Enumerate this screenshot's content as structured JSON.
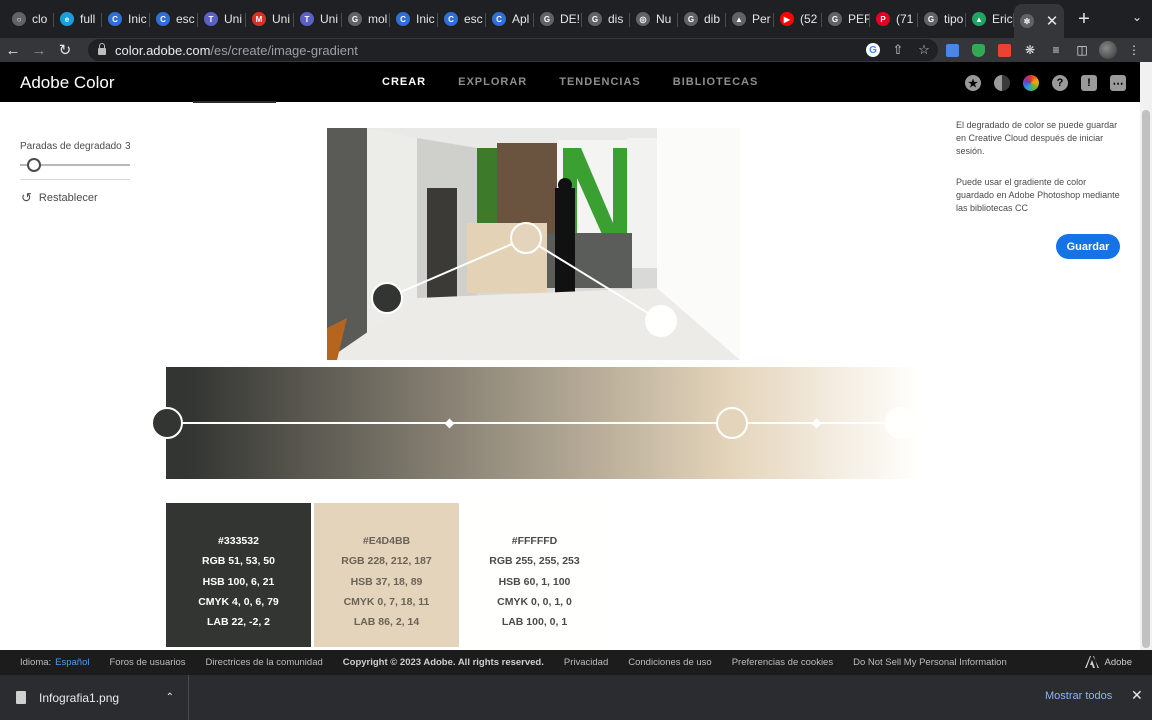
{
  "browser": {
    "tabs": [
      {
        "label": "clo",
        "icon": "globe-icon",
        "color": "#5f6368"
      },
      {
        "label": "full",
        "icon": "edge-icon",
        "color": "#1a9ee0"
      },
      {
        "label": "Inic",
        "icon": "c-icon",
        "color": "#2f6fd6"
      },
      {
        "label": "esc",
        "icon": "c-icon",
        "color": "#2f6fd6"
      },
      {
        "label": "Uni",
        "icon": "teams-icon",
        "color": "#5b5fc7"
      },
      {
        "label": "Uni",
        "icon": "gmail-icon",
        "color": "#d93025"
      },
      {
        "label": "Uni",
        "icon": "teams-icon",
        "color": "#5b5fc7"
      },
      {
        "label": "mol",
        "icon": "google-icon",
        "color": "#5f6368"
      },
      {
        "label": "Inic",
        "icon": "c-icon",
        "color": "#2f6fd6"
      },
      {
        "label": "esc",
        "icon": "c-icon",
        "color": "#2f6fd6"
      },
      {
        "label": "Apl",
        "icon": "c-icon",
        "color": "#2f6fd6"
      },
      {
        "label": "DE!",
        "icon": "google-icon",
        "color": "#5f6368"
      },
      {
        "label": "dis",
        "icon": "google-icon",
        "color": "#5f6368"
      },
      {
        "label": "Nu",
        "icon": "chrome-icon",
        "color": "#5f6368"
      },
      {
        "label": "dib",
        "icon": "google-icon",
        "color": "#5f6368"
      },
      {
        "label": "Per",
        "icon": "triangle-icon",
        "color": "#5f6368"
      },
      {
        "label": "(52",
        "icon": "youtube-icon",
        "color": "#ff0000"
      },
      {
        "label": "PEF",
        "icon": "google-icon",
        "color": "#5f6368"
      },
      {
        "label": "(71",
        "icon": "pinterest-icon",
        "color": "#e60023"
      },
      {
        "label": "tipo",
        "icon": "google-icon",
        "color": "#5f6368"
      },
      {
        "label": "Eric",
        "icon": "drive-icon",
        "color": "#1fa463"
      }
    ],
    "active_tab": {
      "icon": "adobe-color-icon",
      "color": "#5f6368"
    },
    "url_host": "color.adobe.com",
    "url_path": "/es/create/image-gradient"
  },
  "nav": {
    "brand": "Adobe Color",
    "links": [
      "CREAR",
      "EXPLORAR",
      "TENDENCIAS",
      "BIBLIOTECAS"
    ],
    "active": "CREAR"
  },
  "left_panel": {
    "stops_label": "Paradas de degradado",
    "stops_value": "3",
    "reset_label": "Restablecer"
  },
  "image": {
    "picker_colors": [
      "#333532",
      "#e4d4bb",
      "#fffffd"
    ]
  },
  "gradient": {
    "stop_colors": [
      "#333532",
      "#e4d4bb",
      "#fffffd"
    ]
  },
  "swatches": [
    {
      "bg": "#333532",
      "fg": "#ffffff",
      "hex": "#333532",
      "rgb": "RGB 51, 53, 50",
      "hsb": "HSB 100, 6, 21",
      "cmyk": "CMYK 4, 0, 6, 79",
      "lab": "LAB 22, -2, 2"
    },
    {
      "bg": "#e4d4bb",
      "fg": "#6b6357",
      "hex": "#E4D4BB",
      "rgb": "RGB 228, 212, 187",
      "hsb": "HSB 37, 18, 89",
      "cmyk": "CMYK 0, 7, 18, 11",
      "lab": "LAB 86, 2, 14"
    },
    {
      "bg": "#fffffd",
      "fg": "#4b4b4b",
      "hex": "#FFFFFD",
      "rgb": "RGB 255, 255, 253",
      "hsb": "HSB 60, 1, 100",
      "cmyk": "CMYK 0, 0, 1, 0",
      "lab": "LAB 100, 0, 1"
    }
  ],
  "right_panel": {
    "info1": "El degradado de color se puede guardar en Creative Cloud después de iniciar sesión.",
    "info2": "Puede usar el gradiente de color guardado en Adobe Photoshop mediante las bibliotecas CC",
    "save_label": "Guardar",
    "accent": "#1473e6"
  },
  "footer": {
    "language_label": "Idioma:",
    "language_value": "Español",
    "links": [
      "Foros de usuarios",
      "Directrices de la comunidad"
    ],
    "copyright": "Copyright © 2023 Adobe. All rights reserved.",
    "links2": [
      "Privacidad",
      "Condiciones de uso",
      "Preferencias de cookies",
      "Do Not Sell My Personal Information"
    ],
    "adobe": "Adobe"
  },
  "downloads": {
    "file_name": "Infografia1.png",
    "show_all": "Mostrar todos"
  }
}
